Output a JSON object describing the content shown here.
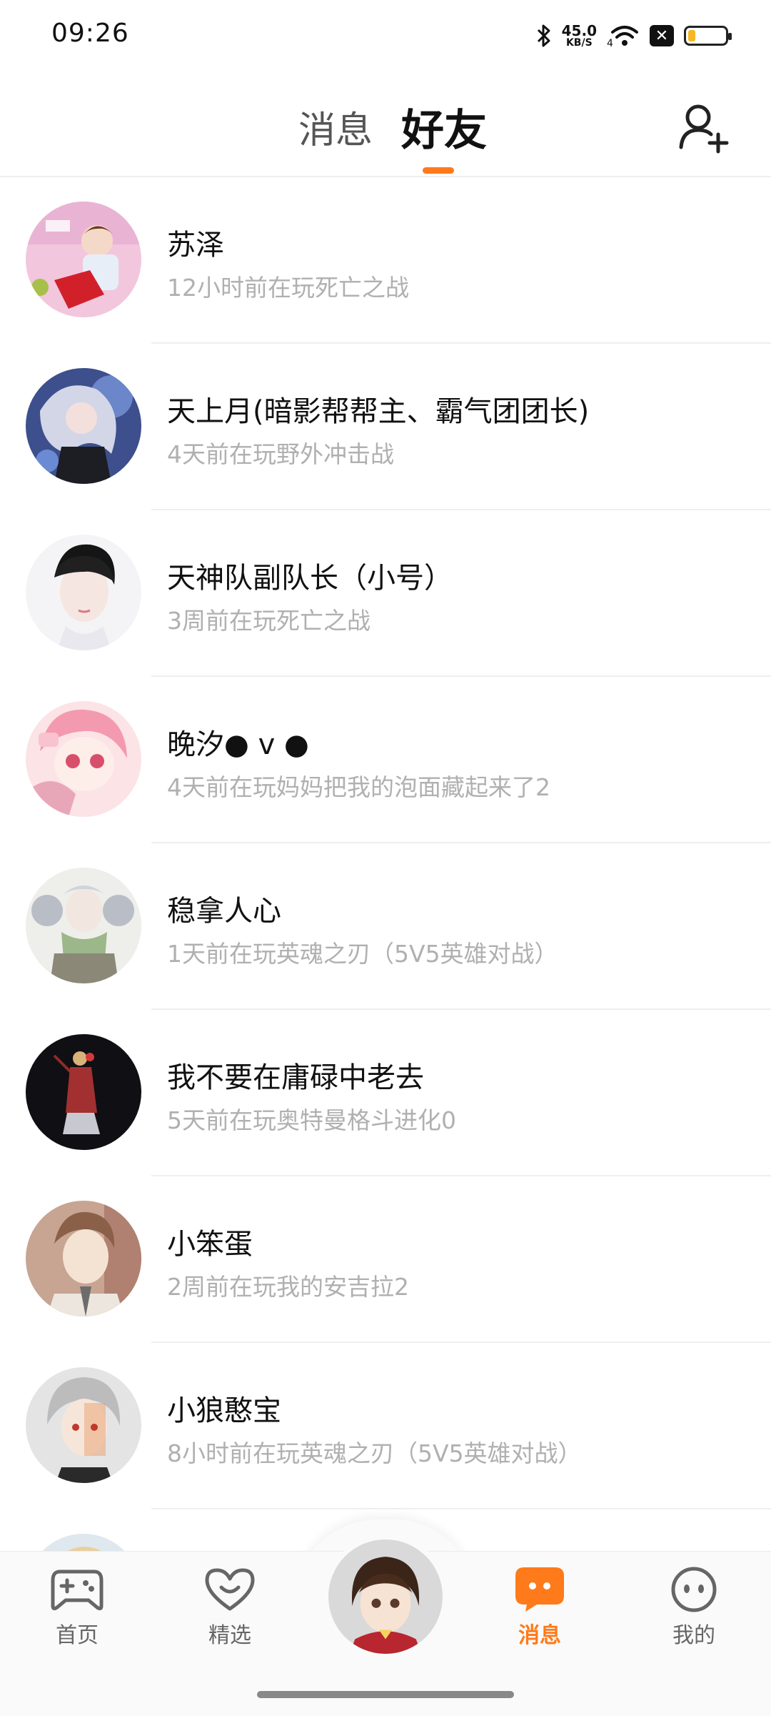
{
  "status_bar": {
    "time": "09:26",
    "net_speed_value": "45.0",
    "net_speed_unit": "KB/S",
    "network": "4G",
    "battery_level": 0.2,
    "icons": [
      "bluetooth-icon",
      "wifi-icon",
      "sim-blocked-icon",
      "battery-icon"
    ]
  },
  "header": {
    "tabs": [
      {
        "label": "消息",
        "active": false
      },
      {
        "label": "好友",
        "active": true
      }
    ],
    "add_friend_icon": "add-user-icon"
  },
  "friends": [
    {
      "name": "苏泽",
      "status": "12小时前在玩死亡之战"
    },
    {
      "name": "天上月(暗影帮帮主、霸气团团长)",
      "status": "4天前在玩野外冲击战"
    },
    {
      "name": "天神队副队长（小号）",
      "status": "3周前在玩死亡之战"
    },
    {
      "name": "晚汐● v ●",
      "status": "4天前在玩妈妈把我的泡面藏起来了2"
    },
    {
      "name": "稳拿人心",
      "status": "1天前在玩英魂之刃（5V5英雄对战）"
    },
    {
      "name": "我不要在庸碌中老去",
      "status": "5天前在玩奥特曼格斗进化0"
    },
    {
      "name": "小笨蛋",
      "status": "2周前在玩我的安吉拉2"
    },
    {
      "name": "小狼憨宝",
      "status": "8小时前在玩英魂之刃（5V5英雄对战）"
    }
  ],
  "bottom_nav": {
    "items": [
      {
        "label": "首页",
        "icon": "gamepad-icon",
        "active": false
      },
      {
        "label": "精选",
        "icon": "heart-icon",
        "active": false
      },
      {
        "label": "消息",
        "icon": "chat-icon",
        "active": true
      },
      {
        "label": "我的",
        "icon": "face-icon",
        "active": false
      }
    ],
    "center_icon": "character-avatar"
  },
  "colors": {
    "accent": "#ff7a1a",
    "muted_text": "#b0b0b0",
    "divider": "#efefef"
  }
}
